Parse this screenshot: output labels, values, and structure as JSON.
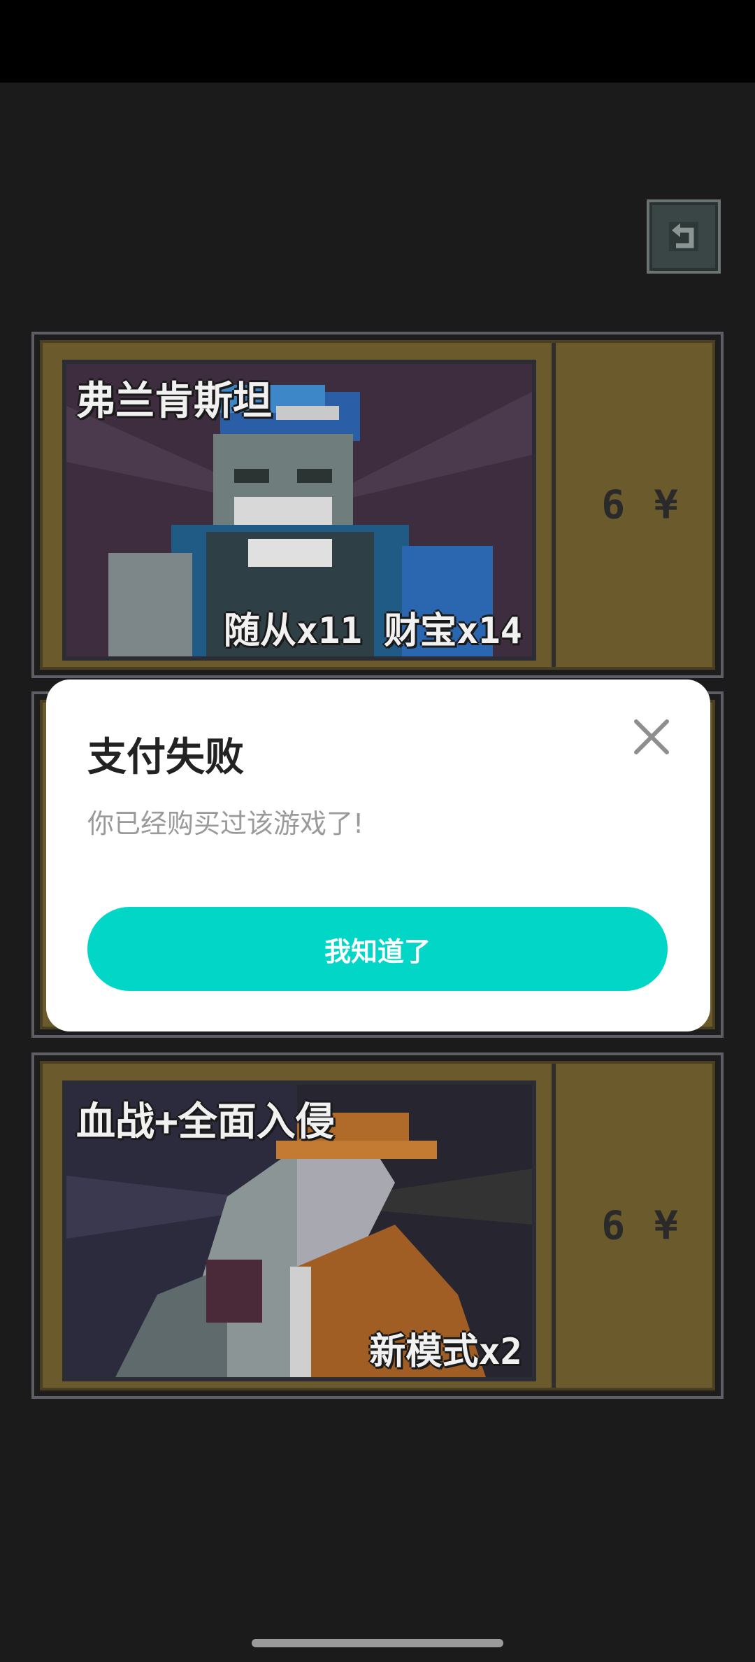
{
  "products": [
    {
      "name": "弗兰肯斯坦",
      "bonus": "随从x11 财宝x14",
      "price": "6 ¥"
    },
    {
      "name": "",
      "bonus": "",
      "price": ""
    },
    {
      "name": "血战+全面入侵",
      "bonus": "新模式x2",
      "price": "6 ¥"
    }
  ],
  "dialog": {
    "title": "支付失败",
    "message": "你已经购买过该游戏了!",
    "confirm_label": "我知道了"
  },
  "icons": {
    "back": "back-arrow-icon",
    "close": "close-icon"
  },
  "colors": {
    "accent": "#02d6c6",
    "card_gold": "#6b5a2c",
    "background": "#1b1b1b"
  }
}
